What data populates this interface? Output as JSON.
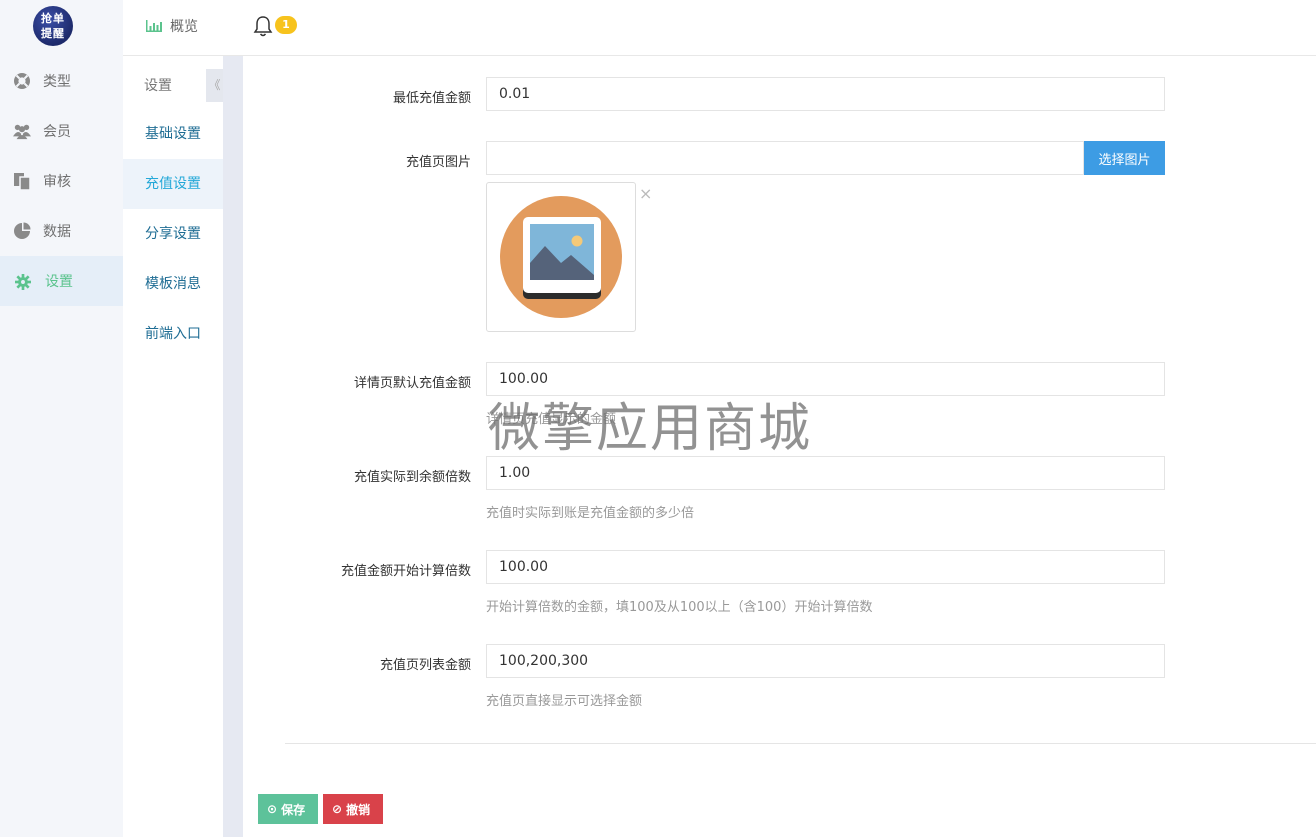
{
  "app": {
    "logo_text_line1": "抢单",
    "logo_text_line2": "提醒"
  },
  "sidebar": {
    "items": [
      {
        "label": "类型",
        "icon": "lifebuoy-icon"
      },
      {
        "label": "会员",
        "icon": "users-icon"
      },
      {
        "label": "审核",
        "icon": "copy-icon"
      },
      {
        "label": "数据",
        "icon": "pie-chart-icon"
      },
      {
        "label": "设置",
        "icon": "gear-icon",
        "active": true
      }
    ]
  },
  "submenu": {
    "title": "设置",
    "collapse_glyph": "《",
    "items": [
      {
        "label": "基础设置"
      },
      {
        "label": "充值设置",
        "active": true
      },
      {
        "label": "分享设置"
      },
      {
        "label": "模板消息"
      },
      {
        "label": "前端入口"
      }
    ]
  },
  "topbar": {
    "overview_label": "概览",
    "notification_count": "1"
  },
  "form": {
    "min_amount": {
      "label": "最低充值金额",
      "value": "0.01"
    },
    "page_image": {
      "label": "充值页图片",
      "value": "",
      "button": "选择图片",
      "remove": "×"
    },
    "default_amount": {
      "label": "详情页默认充值金额",
      "value": "100.00",
      "help": "详情页充值显示的金额"
    },
    "multiplier": {
      "label": "充值实际到余额倍数",
      "value": "1.00",
      "help": "充值时实际到账是充值金额的多少倍"
    },
    "start_multiplier": {
      "label": "充值金额开始计算倍数",
      "value": "100.00",
      "help": "开始计算倍数的金额，填100及从100以上（含100）开始计算倍数"
    },
    "list_amounts": {
      "label": "充值页列表金额",
      "value": "100,200,300",
      "help": "充值页直接显示可选择金额"
    }
  },
  "actions": {
    "save": "保存",
    "cancel": "撤销"
  },
  "watermark": "微擎应用商城",
  "colors": {
    "accent_green": "#5bc38d",
    "link_blue": "#24a8d8",
    "primary_button": "#3d9ce4",
    "save_button": "#5dc29a",
    "cancel_button": "#d9424a",
    "badge": "#f7c31d"
  }
}
